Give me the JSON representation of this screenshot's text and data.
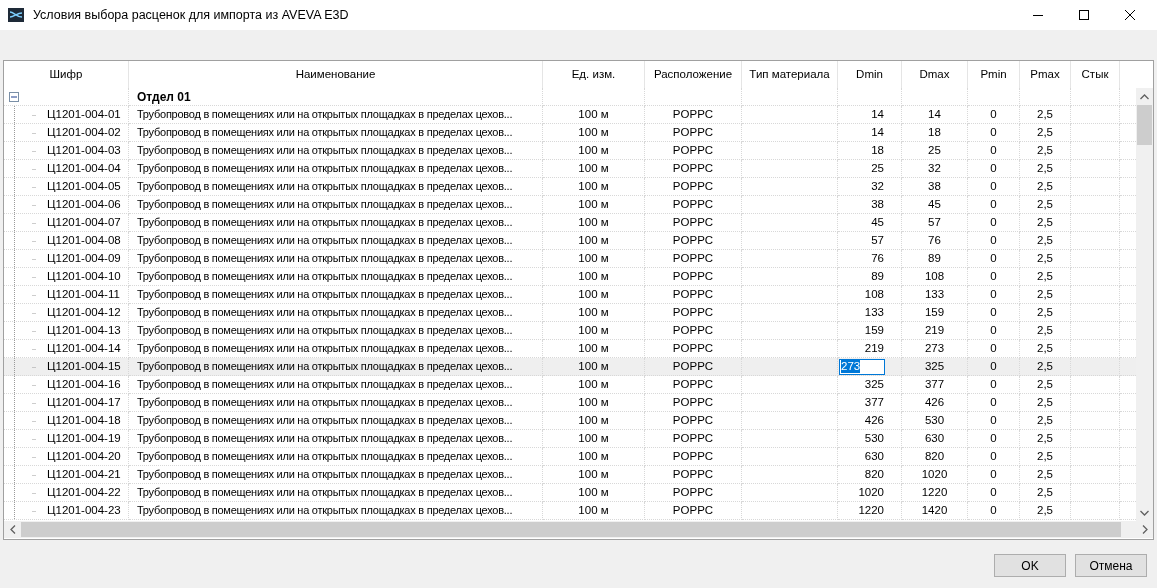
{
  "window": {
    "title": "Условия выбора расценок для импорта из AVEVA E3D"
  },
  "grid": {
    "columns": [
      "Шифр",
      "Наименование",
      "Ед. изм.",
      "Расположение",
      "Тип материала",
      "Dmin",
      "Dmax",
      "Pmin",
      "Pmax",
      "Стык"
    ],
    "groups": [
      {
        "label": "Отдел 01",
        "expanded": true,
        "rows": [
          {
            "code": "Ц1201-004-01",
            "name": "Трубопровод в помещениях или на открытых площадках в пределах цехов...",
            "unit": "100 м",
            "location": "POPPC",
            "dmin": "14",
            "dmax": "14",
            "pmin": "0",
            "pmax": "2,5",
            "selected": false
          },
          {
            "code": "Ц1201-004-02",
            "name": "Трубопровод в помещениях или на открытых площадках в пределах цехов...",
            "unit": "100 м",
            "location": "POPPC",
            "dmin": "14",
            "dmax": "18",
            "pmin": "0",
            "pmax": "2,5",
            "selected": false
          },
          {
            "code": "Ц1201-004-03",
            "name": "Трубопровод в помещениях или на открытых площадках в пределах цехов...",
            "unit": "100 м",
            "location": "POPPC",
            "dmin": "18",
            "dmax": "25",
            "pmin": "0",
            "pmax": "2,5",
            "selected": false
          },
          {
            "code": "Ц1201-004-04",
            "name": "Трубопровод в помещениях или на открытых площадках в пределах цехов...",
            "unit": "100 м",
            "location": "POPPC",
            "dmin": "25",
            "dmax": "32",
            "pmin": "0",
            "pmax": "2,5",
            "selected": false
          },
          {
            "code": "Ц1201-004-05",
            "name": "Трубопровод в помещениях или на открытых площадках в пределах цехов...",
            "unit": "100 м",
            "location": "POPPC",
            "dmin": "32",
            "dmax": "38",
            "pmin": "0",
            "pmax": "2,5",
            "selected": false
          },
          {
            "code": "Ц1201-004-06",
            "name": "Трубопровод в помещениях или на открытых площадках в пределах цехов...",
            "unit": "100 м",
            "location": "POPPC",
            "dmin": "38",
            "dmax": "45",
            "pmin": "0",
            "pmax": "2,5",
            "selected": false
          },
          {
            "code": "Ц1201-004-07",
            "name": "Трубопровод в помещениях или на открытых площадках в пределах цехов...",
            "unit": "100 м",
            "location": "POPPC",
            "dmin": "45",
            "dmax": "57",
            "pmin": "0",
            "pmax": "2,5",
            "selected": false
          },
          {
            "code": "Ц1201-004-08",
            "name": "Трубопровод в помещениях или на открытых площадках в пределах цехов...",
            "unit": "100 м",
            "location": "POPPC",
            "dmin": "57",
            "dmax": "76",
            "pmin": "0",
            "pmax": "2,5",
            "selected": false
          },
          {
            "code": "Ц1201-004-09",
            "name": "Трубопровод в помещениях или на открытых площадках в пределах цехов...",
            "unit": "100 м",
            "location": "POPPC",
            "dmin": "76",
            "dmax": "89",
            "pmin": "0",
            "pmax": "2,5",
            "selected": false
          },
          {
            "code": "Ц1201-004-10",
            "name": "Трубопровод в помещениях или на открытых площадках в пределах цехов...",
            "unit": "100 м",
            "location": "POPPC",
            "dmin": "89",
            "dmax": "108",
            "pmin": "0",
            "pmax": "2,5",
            "selected": false
          },
          {
            "code": "Ц1201-004-11",
            "name": "Трубопровод в помещениях или на открытых площадках в пределах цехов...",
            "unit": "100 м",
            "location": "POPPC",
            "dmin": "108",
            "dmax": "133",
            "pmin": "0",
            "pmax": "2,5",
            "selected": false
          },
          {
            "code": "Ц1201-004-12",
            "name": "Трубопровод в помещениях или на открытых площадках в пределах цехов...",
            "unit": "100 м",
            "location": "POPPC",
            "dmin": "133",
            "dmax": "159",
            "pmin": "0",
            "pmax": "2,5",
            "selected": false
          },
          {
            "code": "Ц1201-004-13",
            "name": "Трубопровод в помещениях или на открытых площадках в пределах цехов...",
            "unit": "100 м",
            "location": "POPPC",
            "dmin": "159",
            "dmax": "219",
            "pmin": "0",
            "pmax": "2,5",
            "selected": false
          },
          {
            "code": "Ц1201-004-14",
            "name": "Трубопровод в помещениях или на открытых площадках в пределах цехов...",
            "unit": "100 м",
            "location": "POPPC",
            "dmin": "219",
            "dmax": "273",
            "pmin": "0",
            "pmax": "2,5",
            "selected": false
          },
          {
            "code": "Ц1201-004-15",
            "name": "Трубопровод в помещениях или на открытых площадках в пределах цехов...",
            "unit": "100 м",
            "location": "POPPC",
            "dmin": "273",
            "dmax": "325",
            "pmin": "0",
            "pmax": "2,5",
            "selected": true
          },
          {
            "code": "Ц1201-004-16",
            "name": "Трубопровод в помещениях или на открытых площадках в пределах цехов...",
            "unit": "100 м",
            "location": "POPPC",
            "dmin": "325",
            "dmax": "377",
            "pmin": "0",
            "pmax": "2,5",
            "selected": false
          },
          {
            "code": "Ц1201-004-17",
            "name": "Трубопровод в помещениях или на открытых площадках в пределах цехов...",
            "unit": "100 м",
            "location": "POPPC",
            "dmin": "377",
            "dmax": "426",
            "pmin": "0",
            "pmax": "2,5",
            "selected": false
          },
          {
            "code": "Ц1201-004-18",
            "name": "Трубопровод в помещениях или на открытых площадках в пределах цехов...",
            "unit": "100 м",
            "location": "POPPC",
            "dmin": "426",
            "dmax": "530",
            "pmin": "0",
            "pmax": "2,5",
            "selected": false
          },
          {
            "code": "Ц1201-004-19",
            "name": "Трубопровод в помещениях или на открытых площадках в пределах цехов...",
            "unit": "100 м",
            "location": "POPPC",
            "dmin": "530",
            "dmax": "630",
            "pmin": "0",
            "pmax": "2,5",
            "selected": false
          },
          {
            "code": "Ц1201-004-20",
            "name": "Трубопровод в помещениях или на открытых площадках в пределах цехов...",
            "unit": "100 м",
            "location": "POPPC",
            "dmin": "630",
            "dmax": "820",
            "pmin": "0",
            "pmax": "2,5",
            "selected": false
          },
          {
            "code": "Ц1201-004-21",
            "name": "Трубопровод в помещениях или на открытых площадках в пределах цехов...",
            "unit": "100 м",
            "location": "POPPC",
            "dmin": "820",
            "dmax": "1020",
            "pmin": "0",
            "pmax": "2,5",
            "selected": false
          },
          {
            "code": "Ц1201-004-22",
            "name": "Трубопровод в помещениях или на открытых площадках в пределах цехов...",
            "unit": "100 м",
            "location": "POPPC",
            "dmin": "1020",
            "dmax": "1220",
            "pmin": "0",
            "pmax": "2,5",
            "selected": false
          },
          {
            "code": "Ц1201-004-23",
            "name": "Трубопровод в помещениях или на открытых площадках в пределах цехов...",
            "unit": "100 м",
            "location": "POPPC",
            "dmin": "1220",
            "dmax": "1420",
            "pmin": "0",
            "pmax": "2,5",
            "selected": false
          }
        ]
      }
    ]
  },
  "buttons": [
    "OK",
    "Отмена"
  ]
}
